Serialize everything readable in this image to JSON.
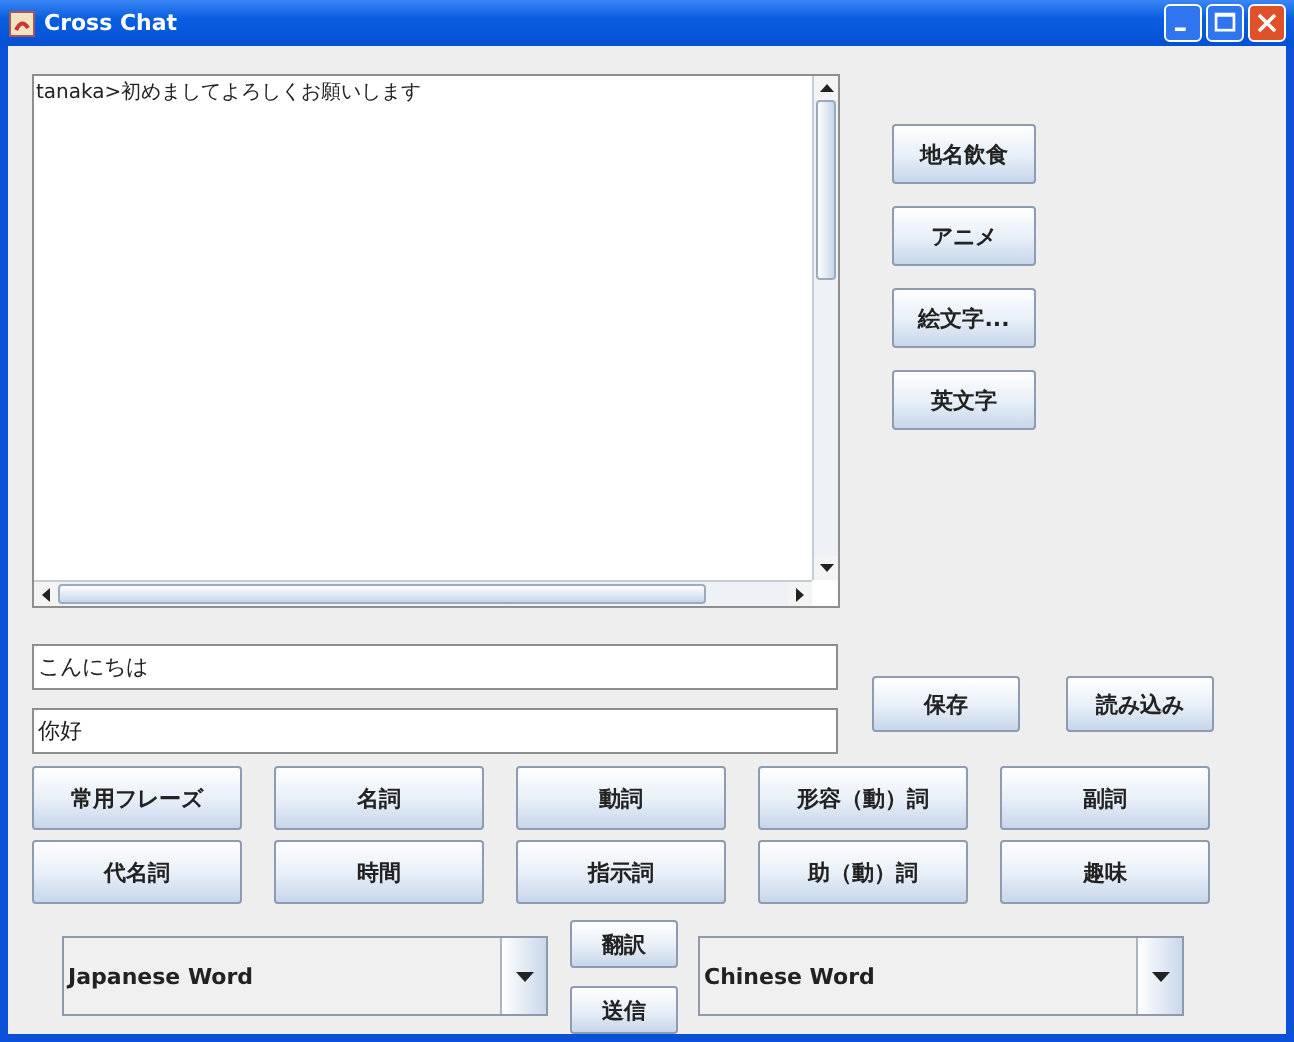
{
  "window": {
    "title": "Cross Chat"
  },
  "chat_log": [
    "tanaka>初めましてよろしくお願いします"
  ],
  "category_buttons": [
    "地名飲食",
    "アニメ",
    "絵文字...",
    "英文字"
  ],
  "japanese_input": {
    "value": "こんにちは"
  },
  "chinese_input": {
    "value": "你好"
  },
  "file_buttons": [
    "保存",
    "読み込み"
  ],
  "word_buttons": [
    "常用フレーズ",
    "名詞",
    "動詞",
    "形容（動）詞",
    "副詞",
    "代名詞",
    "時間",
    "指示詞",
    "助（動）詞",
    "趣味"
  ],
  "japanese_word": {
    "value": "Japanese Word"
  },
  "action_buttons": [
    "翻訳",
    "送信"
  ],
  "chinese_word": {
    "value": "Chinese Word"
  }
}
